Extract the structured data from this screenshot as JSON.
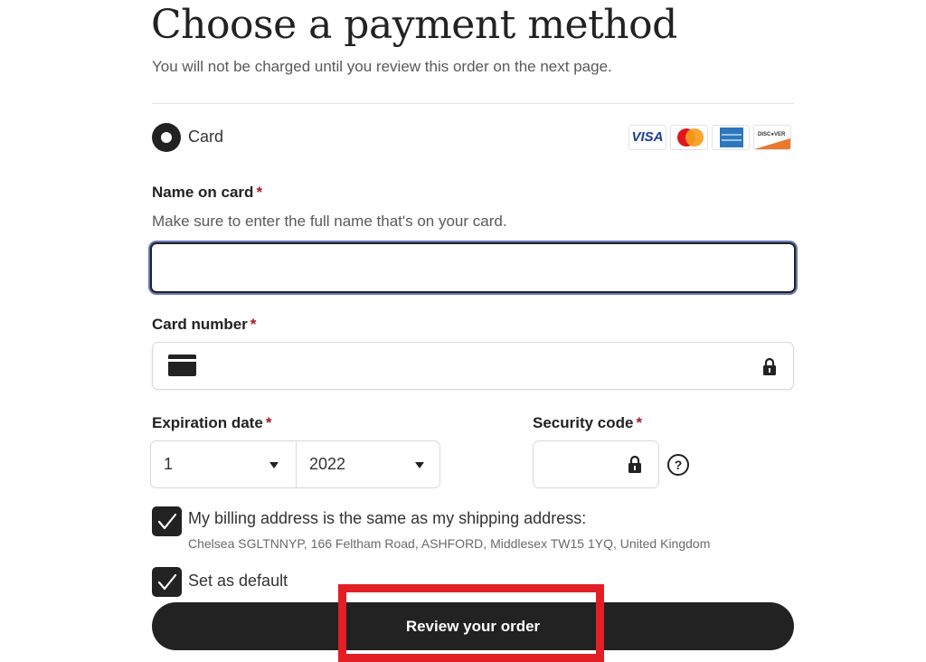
{
  "header": {
    "title": "Choose a payment method",
    "subtitle": "You will not be charged until you review this order on the next page."
  },
  "payment_option": {
    "label": "Card",
    "selected": true,
    "brand_logos": [
      {
        "name": "visa-logo",
        "text": "VISA"
      },
      {
        "name": "mastercard-logo"
      },
      {
        "name": "amex-logo"
      },
      {
        "name": "discover-logo",
        "text": "DISC●VER"
      }
    ]
  },
  "form": {
    "required_marker": "*",
    "name_on_card": {
      "label": "Name on card",
      "help": "Make sure to enter the full name that's on your card.",
      "value": ""
    },
    "card_number": {
      "label": "Card number",
      "value": ""
    },
    "expiration": {
      "label": "Expiration date",
      "month": "1",
      "year": "2022"
    },
    "security_code": {
      "label": "Security code",
      "value": "",
      "help_icon": "?"
    },
    "billing_same": {
      "label": "My billing address is the same as my shipping address:",
      "checked": true,
      "address": "Chelsea SGLTNNYP, 166 Feltham Road, ASHFORD, Middlesex TW15 1YQ, United Kingdom"
    },
    "set_default": {
      "label": "Set as default",
      "checked": true
    }
  },
  "actions": {
    "review_order": "Review your order"
  },
  "colors": {
    "primary": "#222222",
    "required": "#a61a2e",
    "focus_ring": "#6877b8",
    "annotation_highlight": "#e31e24"
  }
}
